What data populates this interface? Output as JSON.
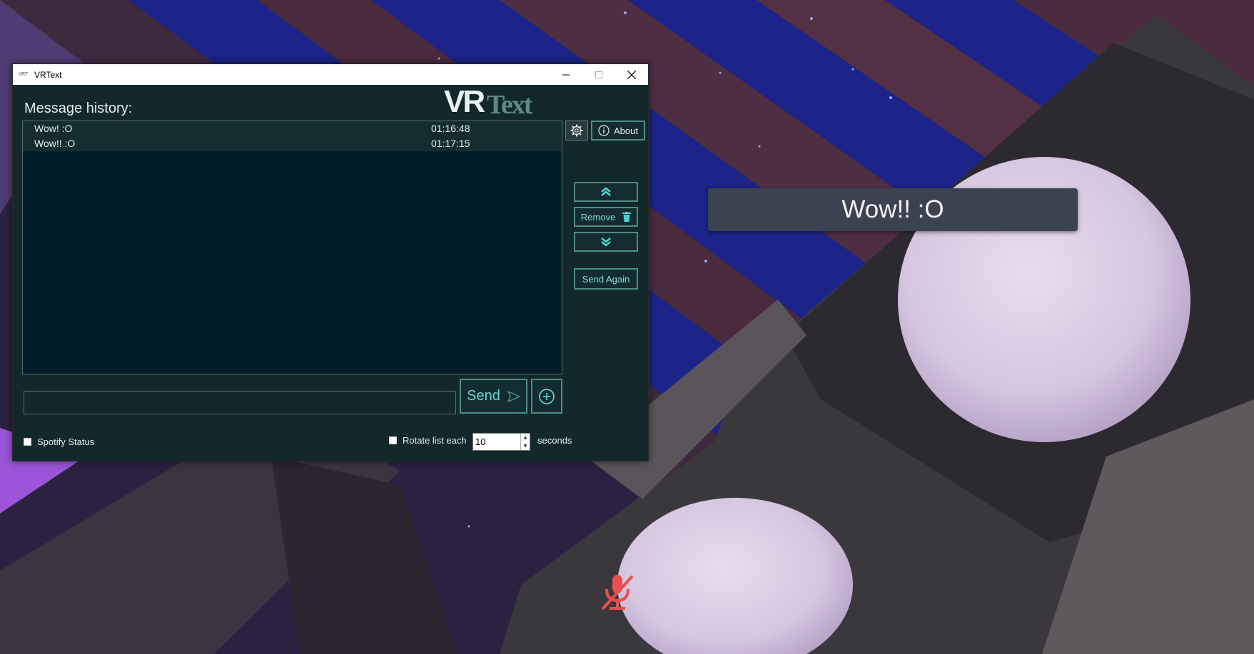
{
  "window": {
    "title": "VRText",
    "app_icon_text": "VRT",
    "logo_text_a": "VR",
    "logo_text_b": "Text"
  },
  "history": {
    "label": "Message history:",
    "items": [
      {
        "message": "Wow! :O",
        "time": "01:16:48"
      },
      {
        "message": "Wow!! :O",
        "time": "01:17:15"
      }
    ]
  },
  "buttons": {
    "about": "About",
    "remove": "Remove",
    "send_again": "Send Again",
    "send": "Send"
  },
  "input": {
    "value": "",
    "placeholder": ""
  },
  "footer": {
    "spotify_label": "Spotify Status",
    "spotify_checked": false,
    "rotate_label": "Rotate list each",
    "rotate_checked": false,
    "rotate_value": "10",
    "seconds_label": "seconds"
  },
  "overlay": {
    "chatbox_text": "Wow!! :O"
  },
  "colors": {
    "window_bg": "#12282b",
    "list_bg": "#021d25",
    "accent": "#4f8c88",
    "accent_text": "#7fe0dc",
    "mute_icon": "#e8504f"
  },
  "icons": [
    "gear-icon",
    "info-icon",
    "double-chevron-up-icon",
    "trash-icon",
    "double-chevron-down-icon",
    "send-arrow-icon",
    "plus-circle-icon",
    "microphone-muted-icon"
  ]
}
